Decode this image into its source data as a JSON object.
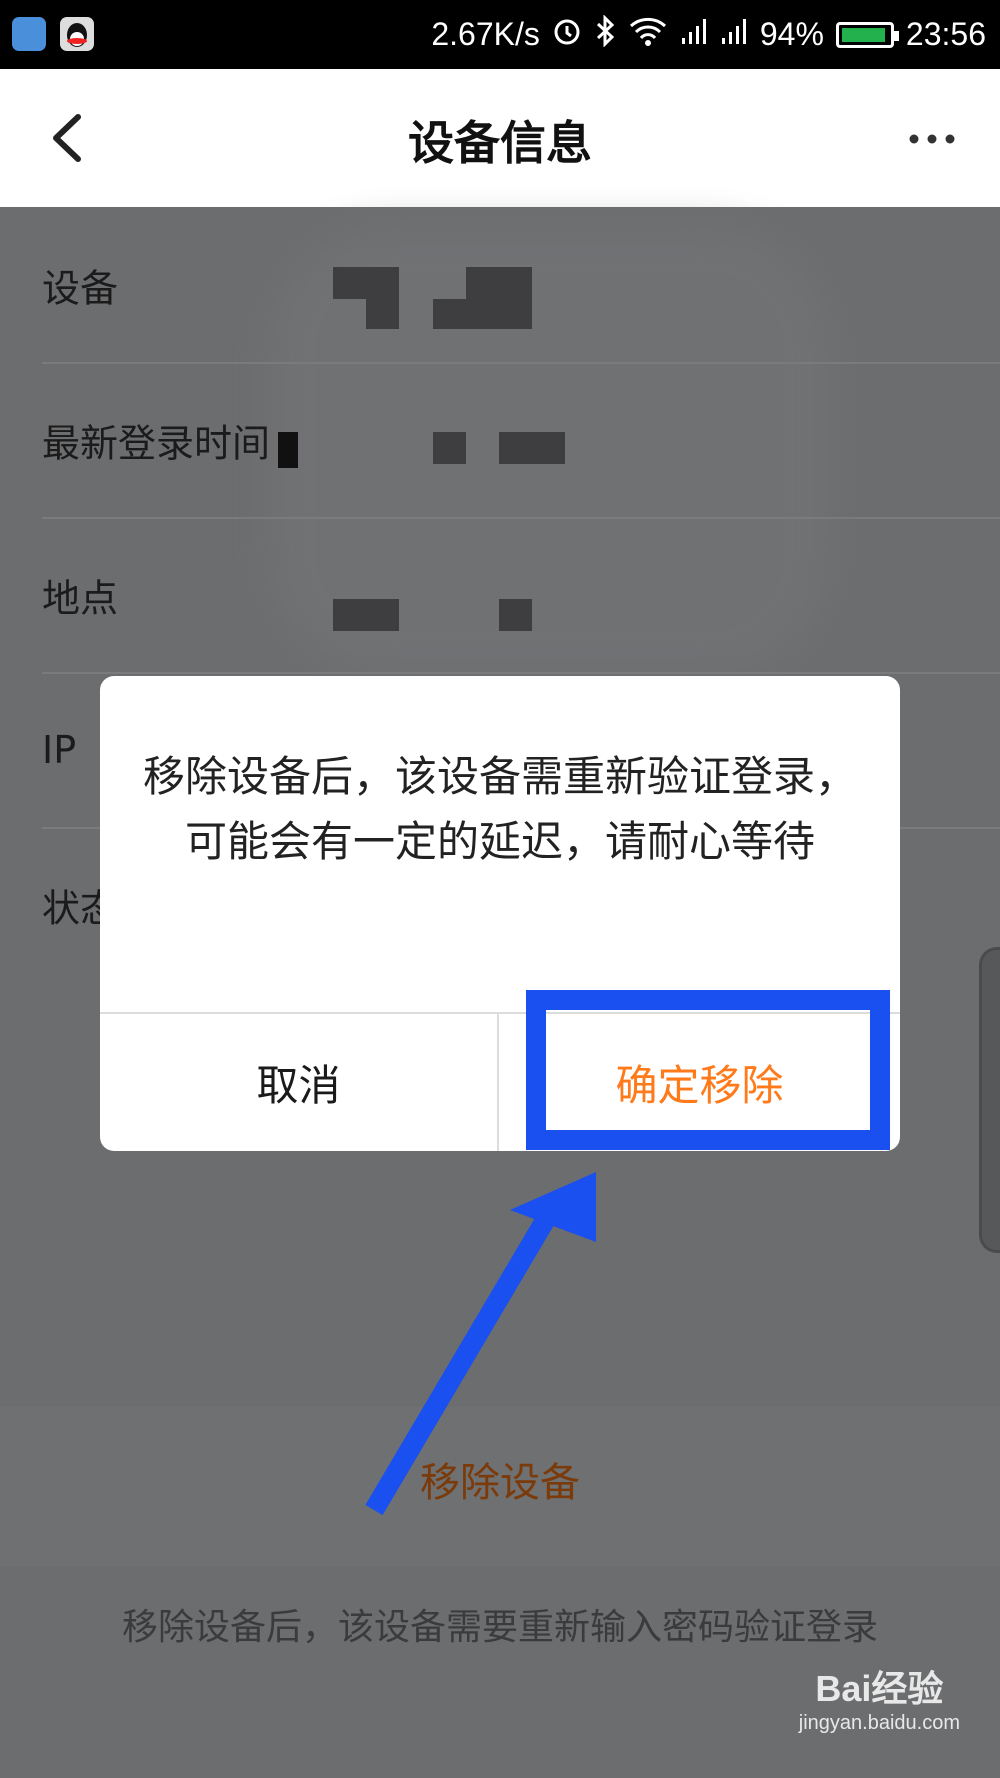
{
  "status_bar": {
    "speed": "2.67K/s",
    "battery": "94%",
    "battery_level": 0.94,
    "time": "23:56",
    "icons": [
      "shield-app-icon",
      "qq-app-icon",
      "alarm-icon",
      "bluetooth-icon",
      "wifi-icon",
      "signal-icon",
      "signal-icon",
      "battery-icon"
    ]
  },
  "nav": {
    "title": "设备信息",
    "back_icon": "chevron-left-icon",
    "more_icon": "more-icon"
  },
  "info_rows": [
    {
      "label": "设备"
    },
    {
      "label": "最新登录时间"
    },
    {
      "label": "地点"
    },
    {
      "label": "IP"
    },
    {
      "label": "状态"
    }
  ],
  "remove_device": {
    "link_label": "移除设备",
    "hint": "移除设备后，该设备需要重新输入密码验证登录"
  },
  "dialog": {
    "message": "移除设备后，该设备需重新验证登录，可能会有一定的延迟，请耐心等待",
    "cancel_label": "取消",
    "confirm_label": "确定移除"
  },
  "watermark": {
    "logo": "Bai经验",
    "sub": "jingyan.baidu.com"
  },
  "colors": {
    "accent": "#ff7a1a",
    "annotation_blue": "#1a4ff0",
    "overlay": "#6c6d6f"
  }
}
